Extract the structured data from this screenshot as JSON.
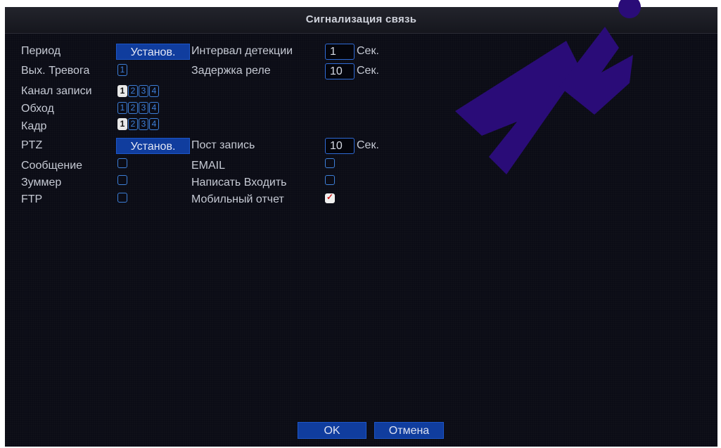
{
  "title": "Сигнализация связь",
  "rows": {
    "period": {
      "label": "Период",
      "button": "Установ."
    },
    "detect_interval": {
      "label": "Интервал детекции",
      "value": "1",
      "unit": "Сек."
    },
    "alarm_out": {
      "label": "Вых. Тревога",
      "channels": [
        "1"
      ]
    },
    "relay_delay": {
      "label": "Задержка реле",
      "value": "10",
      "unit": "Сек."
    },
    "record_channel": {
      "label": "Канал записи",
      "channels": [
        "1",
        "2",
        "3",
        "4"
      ],
      "selected": [
        1
      ]
    },
    "tour": {
      "label": "Обход",
      "channels": [
        "1",
        "2",
        "3",
        "4"
      ],
      "selected": []
    },
    "snapshot": {
      "label": "Кадр",
      "channels": [
        "1",
        "2",
        "3",
        "4"
      ],
      "selected": [
        1
      ]
    },
    "ptz": {
      "label": "PTZ",
      "button": "Установ."
    },
    "post_record": {
      "label": "Пост запись",
      "value": "10",
      "unit": "Сек."
    },
    "message": {
      "label": "Сообщение",
      "checked": false
    },
    "email": {
      "label": "EMAIL",
      "checked": false
    },
    "buzzer": {
      "label": "Зуммер",
      "checked": false
    },
    "write_log": {
      "label": "Написать Входить",
      "checked": false
    },
    "ftp": {
      "label": "FTP",
      "checked": false
    },
    "mobile_report": {
      "label": "Мобильный отчет",
      "checked": true
    }
  },
  "buttons": {
    "ok": "OK",
    "cancel": "Отмена"
  },
  "colors": {
    "background": "#0b0c16",
    "button": "#103d9e",
    "checkbox_border": "#3d7fd8",
    "check_mark": "#d02020",
    "watermark": "#2a0c78"
  }
}
